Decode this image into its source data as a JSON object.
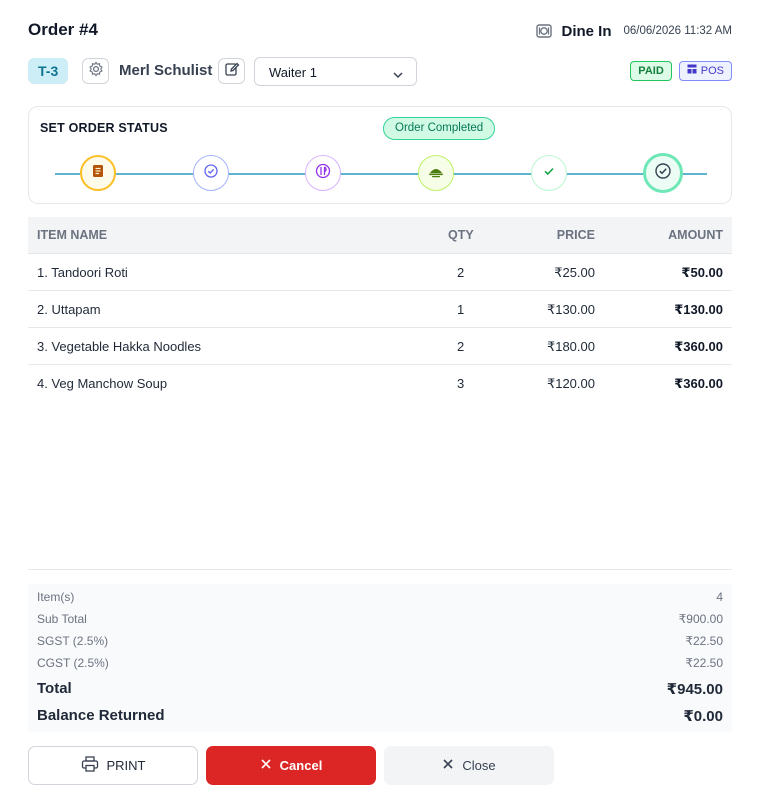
{
  "header": {
    "order_title": "Order #4",
    "order_type": "Dine In",
    "datetime": "06/06/2026 11:32 AM"
  },
  "order_info": {
    "table": "T-3",
    "customer_name": "Merl Schulist",
    "waiter_selected": "Waiter 1",
    "payment_badge": "PAID",
    "source_badge": "POS"
  },
  "status": {
    "label": "SET ORDER STATUS",
    "current": "Order Completed",
    "steps": [
      {
        "icon": "order-placed-icon",
        "color": "#f59e0b"
      },
      {
        "icon": "confirmed-check-icon",
        "color": "#6366f1"
      },
      {
        "icon": "preparing-icon",
        "color": "#a855f7"
      },
      {
        "icon": "food-ready-icon",
        "color": "#84cc16"
      },
      {
        "icon": "served-check-icon",
        "color": "#22c55e"
      },
      {
        "icon": "completed-check-icon",
        "color": "#10b981"
      }
    ]
  },
  "items_table": {
    "headers": {
      "name": "ITEM NAME",
      "qty": "QTY",
      "price": "PRICE",
      "amount": "AMOUNT"
    },
    "rows": [
      {
        "name": "1. Tandoori Roti",
        "qty": "2",
        "price": "₹25.00",
        "amount": "₹50.00"
      },
      {
        "name": "2. Uttapam",
        "qty": "1",
        "price": "₹130.00",
        "amount": "₹130.00"
      },
      {
        "name": "3. Vegetable Hakka Noodles",
        "qty": "2",
        "price": "₹180.00",
        "amount": "₹360.00"
      },
      {
        "name": "4. Veg Manchow Soup",
        "qty": "3",
        "price": "₹120.00",
        "amount": "₹360.00"
      }
    ]
  },
  "summary": {
    "items_label": "Item(s)",
    "items_value": "4",
    "subtotal_label": "Sub Total",
    "subtotal_value": "₹900.00",
    "sgst_label": "SGST (2.5%)",
    "sgst_value": "₹22.50",
    "cgst_label": "CGST (2.5%)",
    "cgst_value": "₹22.50",
    "total_label": "Total",
    "total_value": "₹945.00",
    "balance_label": "Balance Returned",
    "balance_value": "₹0.00"
  },
  "actions": {
    "print_label": "PRINT",
    "cancel_label": "Cancel",
    "close_label": "Close"
  },
  "colors": {
    "accent_teal": "#0e7490",
    "cancel_red": "#dc2626",
    "paid_green": "#15803d",
    "pos_indigo": "#4338ca"
  }
}
